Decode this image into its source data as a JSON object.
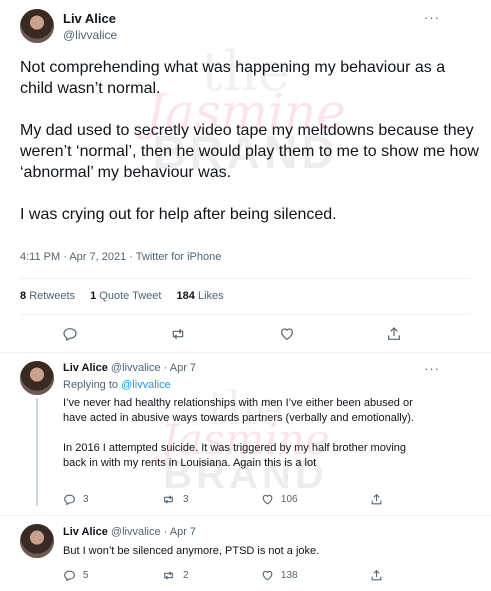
{
  "main_tweet": {
    "author_name": "Liv Alice",
    "author_handle": "@livvalice",
    "paragraphs": [
      "Not comprehending what was happening my behaviour as a child wasn’t normal.",
      "My dad used to secretly video tape my meltdowns because they weren’t ‘normal’, then he would play them to me to show me how ‘abnormal’ my behaviour was.",
      "I was crying out for help after being silenced."
    ],
    "timestamp": "4:11 PM · Apr 7, 2021 · Twitter for iPhone",
    "retweets_count": "8",
    "retweets_label": "Retweets",
    "quotes_count": "1",
    "quotes_label": "Quote Tweet",
    "likes_count": "184",
    "likes_label": "Likes"
  },
  "replies": [
    {
      "author_name": "Liv Alice",
      "handle_date": "@livvalice · Apr 7",
      "replying_prefix": "Replying to",
      "replying_to": "@livvalice",
      "paragraphs": [
        "I’ve never had healthy relationships with men I’ve either been abused or have acted in abusive ways towards partners  (verbally and emotionally).",
        "In 2016 I attempted suicide. It was triggered by my half brother moving back in with my rents in Louisiana. Again this is a lot"
      ],
      "reply_count": "3",
      "retweet_count": "3",
      "like_count": "106"
    },
    {
      "author_name": "Liv Alice",
      "handle_date": "@livvalice · Apr 7",
      "paragraphs": [
        "But I won’t be silenced anymore, PTSD is not a joke."
      ],
      "reply_count": "5",
      "retweet_count": "2",
      "like_count": "138"
    }
  ],
  "watermark": {
    "line1": "the",
    "line2": "Jasmine",
    "line3": "BRAND"
  },
  "more_glyph": "···",
  "icons": {
    "reply": "reply-icon",
    "retweet": "retweet-icon",
    "like": "like-icon",
    "share": "share-icon",
    "more": "more-icon"
  },
  "colors": {
    "text_primary": "#0f1419",
    "text_secondary": "#536471",
    "link": "#1d9bf0",
    "divider": "#eff3f4"
  }
}
